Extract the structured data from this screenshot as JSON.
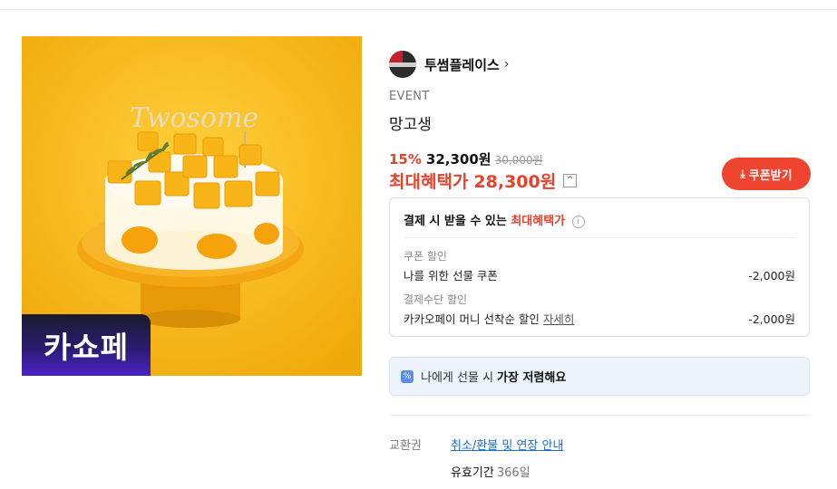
{
  "brand": {
    "name": "투썸플레이스",
    "chevron": "›"
  },
  "product": {
    "event_label": "EVENT",
    "title": "망고생",
    "image_badge": "카쇼페",
    "image_topper_text": "Twosome"
  },
  "pricing": {
    "discount": "15%",
    "price": "32,300원",
    "original_price": "30,000원",
    "max_benefit_label": "최대혜택가",
    "max_benefit_price": "28,300원",
    "collapse_icon": "^"
  },
  "coupon_button": {
    "label": "쿠폰받기",
    "icon": "download-icon"
  },
  "benefit_box": {
    "heading_prefix": "결제 시 받을 수 있는",
    "heading_accent": "최대혜택가",
    "info_icon": "i",
    "sections": [
      {
        "category": "쿠폰 할인",
        "item": "나를 위한 선물 쿠폰",
        "amount": "-2,000원"
      },
      {
        "category": "결제수단 할인",
        "item": "카카오페이 머니 선착순 할인",
        "link": "자세히",
        "amount": "-2,000원"
      }
    ]
  },
  "gift_banner": {
    "prefix": "나에게 선물 시",
    "strong": "가장 저렴해요",
    "icon": "%"
  },
  "voucher": {
    "label": "교환권",
    "policy_link": "취소/환불 및 연장 안내",
    "validity_label": "유효기간",
    "validity_value": "366일"
  },
  "colors": {
    "accent": "#ef4530",
    "sale_red": "#e8412c",
    "link_blue": "#1a6fd1",
    "image_bg": "#f6b91a"
  }
}
